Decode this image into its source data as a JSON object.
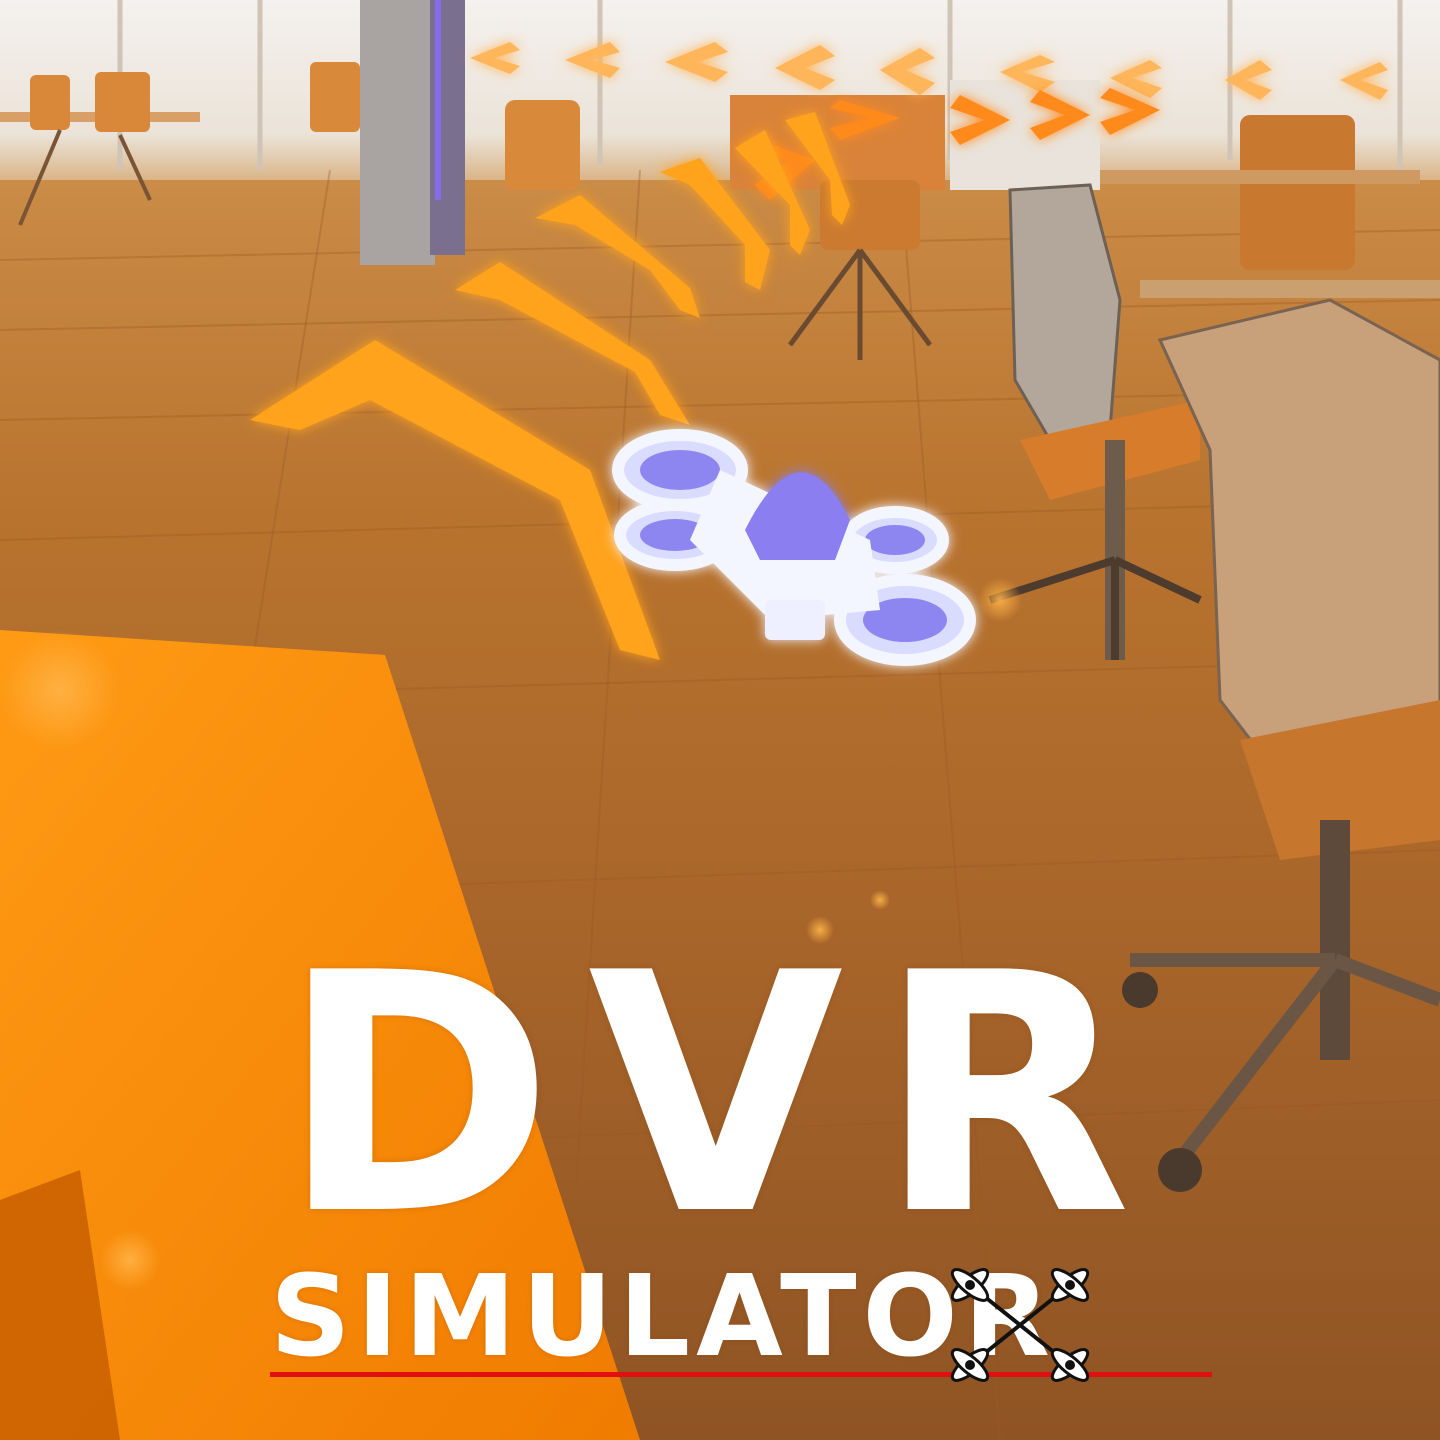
{
  "title": {
    "main": "DVR",
    "sub": "SIMULATOR"
  },
  "icons": {
    "logo_icon": "quadcopter-icon",
    "drone": "micro-quadcopter-drone"
  },
  "colors": {
    "title_text": "#ffffff",
    "underline": "#e01010",
    "gate_arrow": "#ffa21e",
    "gate_glow": "#ff8c00",
    "floor": "#b8732e",
    "drone_frame": "#f4f6ff",
    "drone_canopy": "#8a7ef0"
  }
}
